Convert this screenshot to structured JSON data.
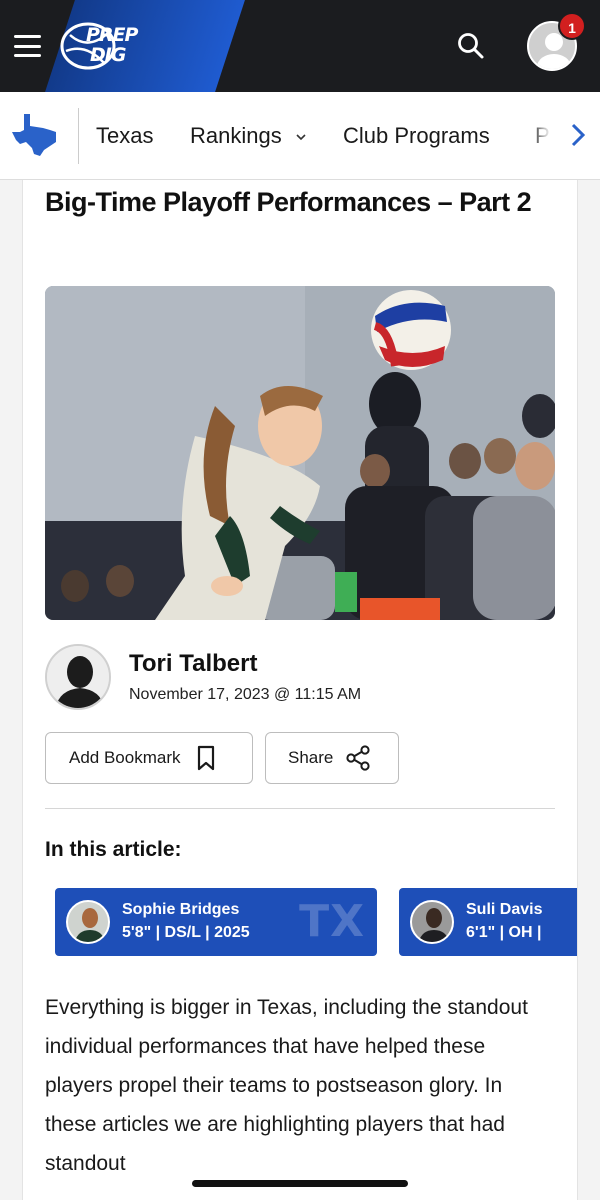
{
  "header": {
    "logo_line1": "PREP",
    "logo_line2": "DIG",
    "notification_count": "1",
    "icons": {
      "menu": "hamburger-icon",
      "search": "search-icon",
      "account": "user-avatar-icon"
    },
    "colors": {
      "bar": "#1b1c1f",
      "accent": "#1f5bd0",
      "badge": "#d21f1f"
    }
  },
  "state_nav": {
    "state_icon": "texas-map-icon",
    "items": [
      {
        "label": "Texas"
      },
      {
        "label": "Rankings"
      },
      {
        "label": "Club Programs"
      },
      {
        "label": "Pr"
      }
    ],
    "more_icon": "chevron-right-icon"
  },
  "article": {
    "title": "Big-Time Playoff Performances – Part 2",
    "image_alt": "Volleyball player passing the ball",
    "author": {
      "name": "Tori Talbert",
      "date": "November 17, 2023 @ 11:15 AM"
    },
    "actions": {
      "bookmark_label": "Add Bookmark",
      "share_label": "Share"
    },
    "in_this_article_label": "In this article:",
    "players": [
      {
        "name": "Sophie Bridges",
        "meta": "5'8\" | DS/L | 2025",
        "state": "TX"
      },
      {
        "name": "Suli Davis",
        "meta": "6'1\" | OH |"
      }
    ],
    "body": "Everything is bigger in Texas, including the standout individual performances that have helped these players propel their teams to postseason glory. In these articles we are highlighting players that had standout"
  }
}
